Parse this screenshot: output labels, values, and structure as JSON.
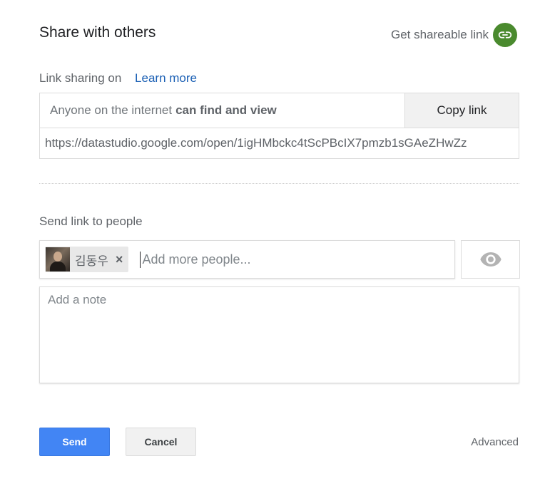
{
  "dialog": {
    "title": "Share with others",
    "shareable_link_label": "Get shareable link",
    "shareable_link_icon": "link-icon",
    "shareable_icon_color": "#4a8a2e"
  },
  "link_sharing": {
    "status_text": "Link sharing on",
    "learn_more_label": "Learn more",
    "access_prefix": "Anyone on the internet",
    "access_level": "can find and view",
    "copy_link_label": "Copy link",
    "url": "https://datastudio.google.com/open/1igHMbckc4tScPBcIX7pmzb1sGAeZHwZz"
  },
  "send": {
    "section_label": "Send link to people",
    "recipients": [
      {
        "name": "김동우"
      }
    ],
    "remove_glyph": "×",
    "people_placeholder": "Add more people...",
    "permission_icon": "eye-icon",
    "note_placeholder": "Add a note"
  },
  "footer": {
    "send_label": "Send",
    "cancel_label": "Cancel",
    "advanced_label": "Advanced",
    "send_color": "#4285f4"
  }
}
